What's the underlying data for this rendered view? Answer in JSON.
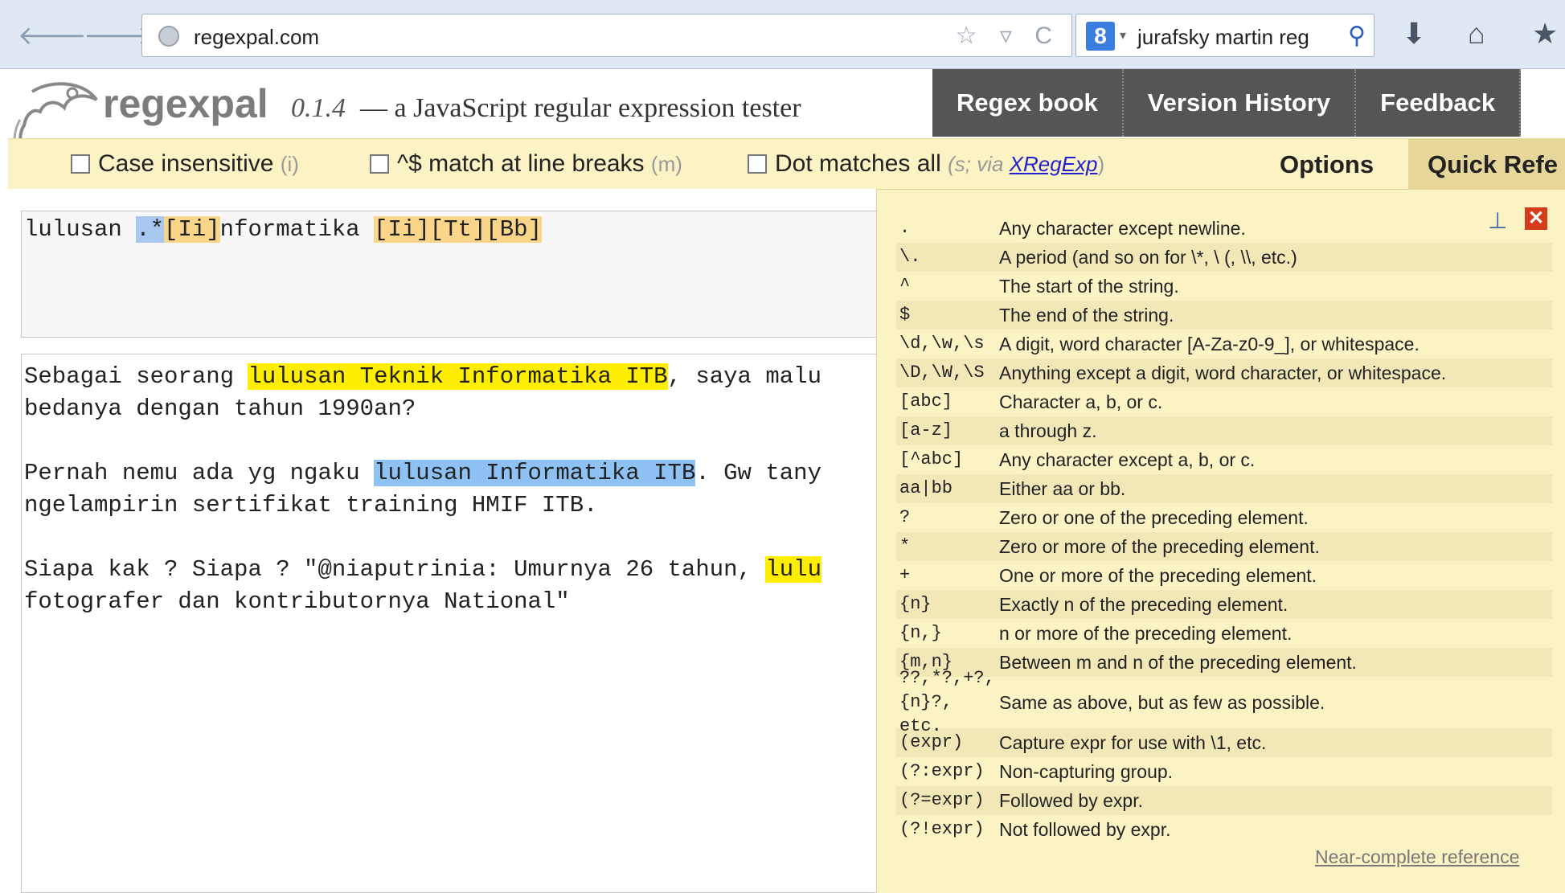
{
  "browser": {
    "url": "regexpal.com",
    "search_text": "jurafsky martin reg",
    "search_engine_icon": "8",
    "back_icon": "🡐",
    "forward_icon": "🡒",
    "url_icons": "☆ ▿ C",
    "search_icon": "⚲",
    "download_icon": "⬇",
    "home_icon": "⌂",
    "bookmarks_icon": "★"
  },
  "header": {
    "brand": "regexpal",
    "version": "0.1.4",
    "tagline": "— a JavaScript regular expression tester",
    "nav": [
      "Regex book",
      "Version History",
      "Feedback"
    ]
  },
  "options": {
    "case_insensitive": "Case insensitive",
    "case_flag": "(i)",
    "line_breaks": "^$ match at line breaks",
    "line_breaks_flag": "(m)",
    "dot_all": "Dot matches all",
    "dot_all_flag_prefix": "(s; via ",
    "dot_all_link": "XRegExp",
    "dot_all_flag_suffix": ")",
    "options_label": "Options",
    "quick_ref_tab": "Quick Refe"
  },
  "regex": {
    "part1": "lulusan ",
    "part2": ".*",
    "part3": "[Ii]",
    "part4": "nformatika ",
    "part5": "[Ii]",
    "part6": "[Tt]",
    "part7": "[Bb]"
  },
  "test_text": {
    "l1_a": "Sebagai seorang ",
    "l1_hl": "lulusan Teknik Informatika ITB",
    "l1_b": ", saya malu",
    "l2": "bedanya dengan tahun 1990an?",
    "l3_a": "Pernah nemu ada yg ngaku ",
    "l3_hl": "lulusan Informatika ITB",
    "l3_b": ". Gw tany",
    "l4": "ngelampirin sertifikat training HMIF ITB.",
    "l5_a": "Siapa kak ? Siapa ? \"@niaputrinia: Umurnya 26 tahun, ",
    "l5_hl": "lulu",
    "l6": "fotografer dan kontributornya National\""
  },
  "quick_reference": {
    "pin_icon": "⊥",
    "close_icon": "✕",
    "rows": [
      {
        "sym": ".",
        "desc": "Any character except newline."
      },
      {
        "sym": "\\.",
        "desc": "A period (and so on for \\*, \\ (, \\\\, etc.)"
      },
      {
        "sym": "^",
        "desc": "The start of the string."
      },
      {
        "sym": "$",
        "desc": "The end of the string."
      },
      {
        "sym": "\\d,\\w,\\s",
        "desc": "A digit, word character [A-Za-z0-9_], or whitespace."
      },
      {
        "sym": "\\D,\\W,\\S",
        "desc": "Anything except a digit, word character, or whitespace."
      },
      {
        "sym": "[abc]",
        "desc": "Character a, b, or c."
      },
      {
        "sym": "[a-z]",
        "desc": "a through z."
      },
      {
        "sym": "[^abc]",
        "desc": "Any character except a, b, or c."
      },
      {
        "sym": "aa|bb",
        "desc": "Either aa or bb."
      },
      {
        "sym": "?",
        "desc": "Zero or one of the preceding element."
      },
      {
        "sym": "*",
        "desc": "Zero or more of the preceding element."
      },
      {
        "sym": "+",
        "desc": "One or more of the preceding element."
      },
      {
        "sym": "{n}",
        "desc": "Exactly n of the preceding element."
      },
      {
        "sym": "{n,}",
        "desc": "n or more of the preceding element."
      },
      {
        "sym": "{m,n}",
        "desc": "Between m and n of the preceding element."
      },
      {
        "sym": "??,*?,+?,\n{n}?, etc.",
        "desc": "Same as above, but as few as possible."
      },
      {
        "sym": "(expr)",
        "desc": "Capture expr for use with \\1, etc."
      },
      {
        "sym": "(?:expr)",
        "desc": "Non-capturing group."
      },
      {
        "sym": "(?=expr)",
        "desc": "Followed by expr."
      },
      {
        "sym": "(?!expr)",
        "desc": "Not followed by expr."
      }
    ],
    "footer_link": "Near-complete reference"
  }
}
